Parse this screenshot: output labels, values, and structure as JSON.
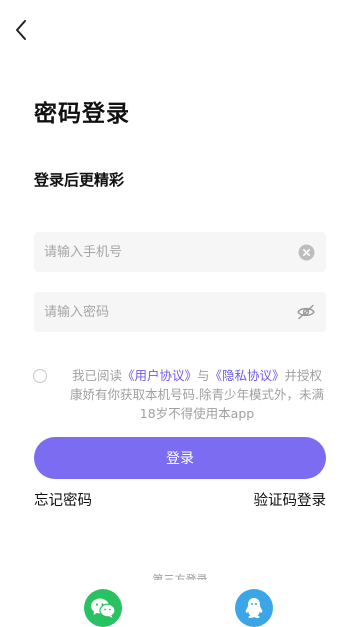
{
  "header": {
    "back_icon": "chevron-left-icon"
  },
  "title": "密码登录",
  "subtitle": "登录后更精彩",
  "form": {
    "phone": {
      "placeholder": "请输入手机号",
      "value": "",
      "clear_icon": "clear-circle-icon"
    },
    "password": {
      "placeholder": "请输入密码",
      "value": "",
      "toggle_icon": "eye-hidden-icon"
    }
  },
  "agreement": {
    "checked": false,
    "prefix": "我已阅读",
    "user_agreement": "《用户协议》",
    "and": "与",
    "privacy_policy": "《隐私协议》",
    "suffix": "并授权康娇有你获取本机号码.除青少年模式外，未满18岁不得使用本app"
  },
  "login_button": "登录",
  "links": {
    "forgot_password": "忘记密码",
    "code_login": "验证码登录"
  },
  "third_party": {
    "label": "第三方登录",
    "providers": [
      {
        "name": "wechat",
        "icon": "wechat-icon"
      },
      {
        "name": "qq",
        "icon": "qq-icon"
      }
    ]
  },
  "colors": {
    "accent": "#7b6cf2",
    "link": "#6f5be8",
    "wechat": "#29c262",
    "qq": "#3aa6e8",
    "field_bg": "#f6f6f6"
  }
}
